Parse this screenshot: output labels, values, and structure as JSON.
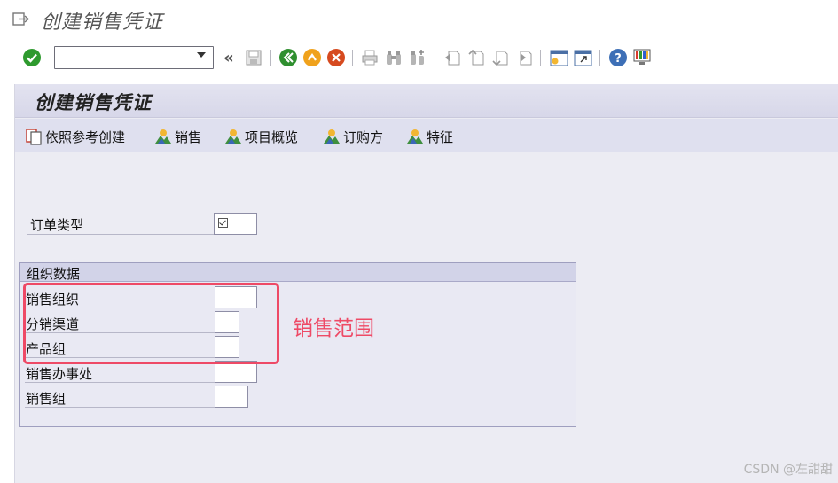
{
  "window": {
    "title": "创建销售凭证"
  },
  "system_toolbar": {
    "command_field": {
      "value": "",
      "placeholder": ""
    },
    "double_arrow": "«"
  },
  "screen": {
    "title": "创建销售凭证",
    "app_toolbar": [
      {
        "label": "依照参考创建",
        "icon": "copy-reference-icon"
      },
      {
        "label": "销售",
        "icon": "mountain-sun-icon"
      },
      {
        "label": "项目概览",
        "icon": "mountain-sun-icon"
      },
      {
        "label": "订购方",
        "icon": "mountain-sun-icon"
      },
      {
        "label": "特征",
        "icon": "mountain-sun-icon"
      }
    ]
  },
  "form": {
    "order_type": {
      "label": "订单类型",
      "value": ""
    },
    "org_data": {
      "title": "组织数据",
      "fields": [
        {
          "label": "销售组织",
          "value": ""
        },
        {
          "label": "分销渠道",
          "value": ""
        },
        {
          "label": "产品组",
          "value": ""
        },
        {
          "label": "销售办事处",
          "value": ""
        },
        {
          "label": "销售组",
          "value": ""
        }
      ]
    }
  },
  "annotation": {
    "text": "销售范围",
    "color": "#ee4a66"
  },
  "watermark": "CSDN @左甜甜"
}
